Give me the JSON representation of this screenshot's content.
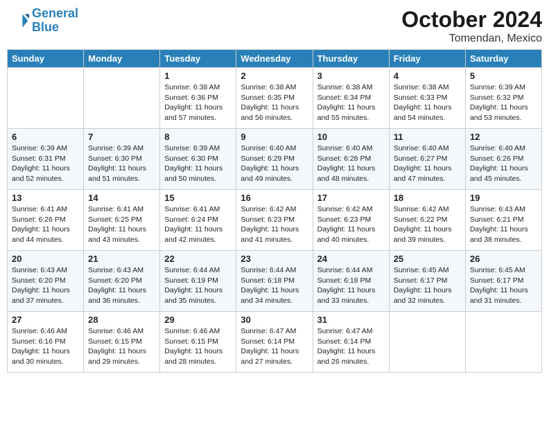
{
  "header": {
    "logo_line1": "General",
    "logo_line2": "Blue",
    "month": "October 2024",
    "location": "Tomendan, Mexico"
  },
  "days_of_week": [
    "Sunday",
    "Monday",
    "Tuesday",
    "Wednesday",
    "Thursday",
    "Friday",
    "Saturday"
  ],
  "weeks": [
    [
      {
        "day": "",
        "info": ""
      },
      {
        "day": "",
        "info": ""
      },
      {
        "day": "1",
        "info": "Sunrise: 6:38 AM\nSunset: 6:36 PM\nDaylight: 11 hours and 57 minutes."
      },
      {
        "day": "2",
        "info": "Sunrise: 6:38 AM\nSunset: 6:35 PM\nDaylight: 11 hours and 56 minutes."
      },
      {
        "day": "3",
        "info": "Sunrise: 6:38 AM\nSunset: 6:34 PM\nDaylight: 11 hours and 55 minutes."
      },
      {
        "day": "4",
        "info": "Sunrise: 6:38 AM\nSunset: 6:33 PM\nDaylight: 11 hours and 54 minutes."
      },
      {
        "day": "5",
        "info": "Sunrise: 6:39 AM\nSunset: 6:32 PM\nDaylight: 11 hours and 53 minutes."
      }
    ],
    [
      {
        "day": "6",
        "info": "Sunrise: 6:39 AM\nSunset: 6:31 PM\nDaylight: 11 hours and 52 minutes."
      },
      {
        "day": "7",
        "info": "Sunrise: 6:39 AM\nSunset: 6:30 PM\nDaylight: 11 hours and 51 minutes."
      },
      {
        "day": "8",
        "info": "Sunrise: 6:39 AM\nSunset: 6:30 PM\nDaylight: 11 hours and 50 minutes."
      },
      {
        "day": "9",
        "info": "Sunrise: 6:40 AM\nSunset: 6:29 PM\nDaylight: 11 hours and 49 minutes."
      },
      {
        "day": "10",
        "info": "Sunrise: 6:40 AM\nSunset: 6:28 PM\nDaylight: 11 hours and 48 minutes."
      },
      {
        "day": "11",
        "info": "Sunrise: 6:40 AM\nSunset: 6:27 PM\nDaylight: 11 hours and 47 minutes."
      },
      {
        "day": "12",
        "info": "Sunrise: 6:40 AM\nSunset: 6:26 PM\nDaylight: 11 hours and 45 minutes."
      }
    ],
    [
      {
        "day": "13",
        "info": "Sunrise: 6:41 AM\nSunset: 6:26 PM\nDaylight: 11 hours and 44 minutes."
      },
      {
        "day": "14",
        "info": "Sunrise: 6:41 AM\nSunset: 6:25 PM\nDaylight: 11 hours and 43 minutes."
      },
      {
        "day": "15",
        "info": "Sunrise: 6:41 AM\nSunset: 6:24 PM\nDaylight: 11 hours and 42 minutes."
      },
      {
        "day": "16",
        "info": "Sunrise: 6:42 AM\nSunset: 6:23 PM\nDaylight: 11 hours and 41 minutes."
      },
      {
        "day": "17",
        "info": "Sunrise: 6:42 AM\nSunset: 6:23 PM\nDaylight: 11 hours and 40 minutes."
      },
      {
        "day": "18",
        "info": "Sunrise: 6:42 AM\nSunset: 6:22 PM\nDaylight: 11 hours and 39 minutes."
      },
      {
        "day": "19",
        "info": "Sunrise: 6:43 AM\nSunset: 6:21 PM\nDaylight: 11 hours and 38 minutes."
      }
    ],
    [
      {
        "day": "20",
        "info": "Sunrise: 6:43 AM\nSunset: 6:20 PM\nDaylight: 11 hours and 37 minutes."
      },
      {
        "day": "21",
        "info": "Sunrise: 6:43 AM\nSunset: 6:20 PM\nDaylight: 11 hours and 36 minutes."
      },
      {
        "day": "22",
        "info": "Sunrise: 6:44 AM\nSunset: 6:19 PM\nDaylight: 11 hours and 35 minutes."
      },
      {
        "day": "23",
        "info": "Sunrise: 6:44 AM\nSunset: 6:18 PM\nDaylight: 11 hours and 34 minutes."
      },
      {
        "day": "24",
        "info": "Sunrise: 6:44 AM\nSunset: 6:18 PM\nDaylight: 11 hours and 33 minutes."
      },
      {
        "day": "25",
        "info": "Sunrise: 6:45 AM\nSunset: 6:17 PM\nDaylight: 11 hours and 32 minutes."
      },
      {
        "day": "26",
        "info": "Sunrise: 6:45 AM\nSunset: 6:17 PM\nDaylight: 11 hours and 31 minutes."
      }
    ],
    [
      {
        "day": "27",
        "info": "Sunrise: 6:46 AM\nSunset: 6:16 PM\nDaylight: 11 hours and 30 minutes."
      },
      {
        "day": "28",
        "info": "Sunrise: 6:46 AM\nSunset: 6:15 PM\nDaylight: 11 hours and 29 minutes."
      },
      {
        "day": "29",
        "info": "Sunrise: 6:46 AM\nSunset: 6:15 PM\nDaylight: 11 hours and 28 minutes."
      },
      {
        "day": "30",
        "info": "Sunrise: 6:47 AM\nSunset: 6:14 PM\nDaylight: 11 hours and 27 minutes."
      },
      {
        "day": "31",
        "info": "Sunrise: 6:47 AM\nSunset: 6:14 PM\nDaylight: 11 hours and 26 minutes."
      },
      {
        "day": "",
        "info": ""
      },
      {
        "day": "",
        "info": ""
      }
    ]
  ]
}
